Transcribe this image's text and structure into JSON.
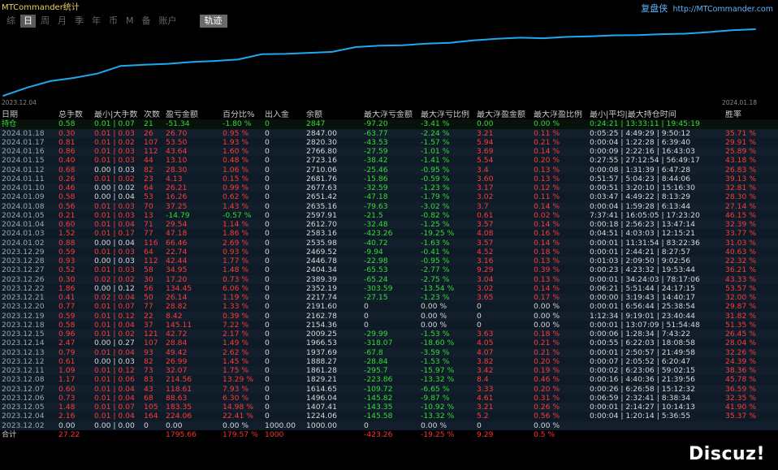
{
  "window": {
    "title_overlay": "MTCommander统计",
    "brand_name": "复盘侠",
    "brand_url": "http://MTCommander.com"
  },
  "tabs": [
    "综",
    "日",
    "周",
    "月",
    "季",
    "年",
    "币",
    "M",
    "备",
    "账户"
  ],
  "active_tab": "日",
  "track_button": "轨迹",
  "colors": {
    "positive": "#ff3b3b",
    "negative": "#33dd33",
    "line": "#1ea8f0"
  },
  "chart_data": {
    "type": "line",
    "x_tick_labels": [
      "2023.12.04",
      "2024.01.18"
    ],
    "series": [
      {
        "x": [
          "2023.12.02",
          "2023.12.04",
          "2023.12.05",
          "2023.12.06",
          "2023.12.07",
          "2023.12.08",
          "2023.12.11",
          "2023.12.12",
          "2023.12.13",
          "2023.12.14",
          "2023.12.15",
          "2023.12.18",
          "2023.12.19",
          "2023.12.20",
          "2023.12.21",
          "2023.12.22",
          "2023.12.26",
          "2023.12.27",
          "2023.12.28",
          "2023.12.29",
          "2024.01.02",
          "2024.01.03",
          "2024.01.04",
          "2024.01.05",
          "2024.01.08",
          "2024.01.09",
          "2024.01.10",
          "2024.01.11",
          "2024.01.12",
          "2024.01.15",
          "2024.01.16",
          "2024.01.17",
          "2024.01.18"
        ],
        "y": [
          1000,
          1224.06,
          1407.41,
          1496.04,
          1614.65,
          1829.21,
          1861.28,
          1888.27,
          1937.69,
          1966.53,
          2009.25,
          2154.36,
          2162.78,
          2191.6,
          2217.74,
          2352.19,
          2389.39,
          2404.34,
          2446.78,
          2469.52,
          2535.98,
          2583.16,
          2612.7,
          2597.91,
          2635.16,
          2651.42,
          2677.63,
          2681.76,
          2710.06,
          2723.16,
          2766.8,
          2820.3,
          2847
        ]
      }
    ]
  },
  "table": {
    "headers": [
      "日期",
      "总手数",
      "最小|大手数",
      "次数",
      "盈亏金额",
      "百分比%",
      "出入金",
      "余额",
      "最大浮亏金额",
      "最大浮亏比例",
      "最大浮盈金额",
      "最大浮盈比例",
      "最小|平均|最大持仓时间",
      "胜率"
    ],
    "holding": [
      "持仓",
      "0.58",
      "0.01 | 0.07",
      "21",
      "-51.34",
      "-1.80 %",
      "0",
      "2847",
      "-97.20",
      "-3.41 %",
      "0.00",
      "0.00 %",
      "0:24:21 | 13:33:11 | 19:45:19",
      ""
    ],
    "rows": [
      [
        "2024.01.18",
        "0.30",
        "0.01 | 0.03",
        "26",
        "26.70",
        "0.95 %",
        "0",
        "2847.00",
        "-63.77",
        "-2.24 %",
        "3.21",
        "0.11 %",
        "0:05:25 | 4:49:29 | 9:50:12",
        "35.71 %"
      ],
      [
        "2024.01.17",
        "0.81",
        "0.01 | 0.02",
        "107",
        "53.50",
        "1.93 %",
        "0",
        "2820.30",
        "-43.53",
        "-1.57 %",
        "5.94",
        "0.21 %",
        "0:00:04 | 1:22:28 | 6:39:40",
        "29.91 %"
      ],
      [
        "2024.01.16",
        "0.86",
        "0.01 | 0.03",
        "112",
        "43.64",
        "1.60 %",
        "0",
        "2766.80",
        "-27.59",
        "-1.01 %",
        "3.69",
        "0.14 %",
        "0:00:09 | 2:22:16 | 16:43:03",
        "25.89 %"
      ],
      [
        "2024.01.15",
        "0.40",
        "0.01 | 0.03",
        "44",
        "13.10",
        "0.48 %",
        "0",
        "2723.16",
        "-38.42",
        "-1.41 %",
        "5.54",
        "0.20 %",
        "0:27:55 | 27:12:54 | 56:49:17",
        "43.18 %"
      ],
      [
        "2024.01.12",
        "0.68",
        "0.00 | 0.03",
        "82",
        "28.30",
        "1.06 %",
        "0",
        "2710.06",
        "-25.46",
        "-0.95 %",
        "3.4",
        "0.13 %",
        "0:00:08 | 1:31:39 | 6:47:28",
        "26.83 %"
      ],
      [
        "2024.01.11",
        "0.26",
        "0.01 | 0.02",
        "23",
        "4.13",
        "0.15 %",
        "0",
        "2681.76",
        "-15.86",
        "-0.59 %",
        "3.60",
        "0.13 %",
        "0:51:57 | 5:04:23 | 8:44:06",
        "39.13 %"
      ],
      [
        "2024.01.10",
        "0.46",
        "0.00 | 0.02",
        "64",
        "26.21",
        "0.99 %",
        "0",
        "2677.63",
        "-32.59",
        "-1.23 %",
        "3.17",
        "0.12 %",
        "0:00:51 | 3:20:10 | 15:16:30",
        "32.81 %"
      ],
      [
        "2024.01.09",
        "0.58",
        "0.00 | 0.04",
        "53",
        "16.26",
        "0.62 %",
        "0",
        "2651.42",
        "-47.18",
        "-1.79 %",
        "3.02",
        "0.11 %",
        "0:03:47 | 4:49:22 | 8:13:29",
        "28.30 %"
      ],
      [
        "2024.01.08",
        "0.56",
        "0.01 | 0.03",
        "70",
        "37.25",
        "1.43 %",
        "0",
        "2635.16",
        "-79.63",
        "-3.02 %",
        "3.7",
        "0.14 %",
        "0:00:04 | 1:59:28 | 6:13:44",
        "27.14 %"
      ],
      [
        "2024.01.05",
        "0.21",
        "0.01 | 0.03",
        "13",
        "-14.79",
        "-0.57 %",
        "0",
        "2597.91",
        "-21.5",
        "-0.82 %",
        "0.61",
        "0.02 %",
        "7:37:41 | 16:05:05 | 17:23:20",
        "46.15 %"
      ],
      [
        "2024.01.04",
        "0.60",
        "0.01 | 0.04",
        "71",
        "29.54",
        "1.14 %",
        "0",
        "2612.70",
        "-32.48",
        "-1.25 %",
        "3.57",
        "0.14 %",
        "0:00:18 | 2:56:23 | 13:47:14",
        "32.39 %"
      ],
      [
        "2024.01.03",
        "1.52",
        "0.01 | 0.17",
        "77",
        "47.18",
        "1.86 %",
        "0",
        "2583.16",
        "-423.26",
        "-19.25 %",
        "4.08",
        "0.16 %",
        "0:04:51 | 4:03:03 | 12:15:21",
        "33.77 %"
      ],
      [
        "2024.01.02",
        "0.88",
        "0.00 | 0.04",
        "116",
        "66.46",
        "2.69 %",
        "0",
        "2535.98",
        "-40.72",
        "-1.63 %",
        "3.57",
        "0.14 %",
        "0:00:01 | 11:31:54 | 83:22:36",
        "31.03 %"
      ],
      [
        "2023.12.29",
        "0.59",
        "0.01 | 0.03",
        "64",
        "22.74",
        "0.93 %",
        "0",
        "2469.52",
        "-9.94",
        "-0.41 %",
        "4.52",
        "0.18 %",
        "0:00:01 | 2:44:21 | 8:27:57",
        "40.63 %"
      ],
      [
        "2023.12.28",
        "0.93",
        "0.00 | 0.03",
        "112",
        "42.44",
        "1.77 %",
        "0",
        "2446.78",
        "-22.98",
        "-0.95 %",
        "3.16",
        "0.13 %",
        "0:01:03 | 2:09:50 | 9:02:56",
        "22.32 %"
      ],
      [
        "2023.12.27",
        "0.52",
        "0.01 | 0.03",
        "58",
        "34.95",
        "1.48 %",
        "0",
        "2404.34",
        "-65.53",
        "-2.77 %",
        "9.29",
        "0.39 %",
        "0:00:23 | 4:23:32 | 19:53:44",
        "36.21 %"
      ],
      [
        "2023.12.26",
        "0.30",
        "0.02 | 0.02",
        "30",
        "17.20",
        "0.73 %",
        "0",
        "2389.39",
        "-65.24",
        "-2.75 %",
        "3.04",
        "0.13 %",
        "0:00:01 | 34:24:03 | 78:17:06",
        "43.33 %"
      ],
      [
        "2023.12.22",
        "1.86",
        "0.00 | 0.12",
        "56",
        "134.45",
        "6.06 %",
        "0",
        "2352.19",
        "-303.59",
        "-13.54 %",
        "3.02",
        "0.14 %",
        "0:06:21 | 5:51:44 | 24:17:15",
        "53.57 %"
      ],
      [
        "2023.12.21",
        "0.41",
        "0.02 | 0.04",
        "50",
        "26.14",
        "1.19 %",
        "0",
        "2217.74",
        "-27.15",
        "-1.23 %",
        "3.65",
        "0.17 %",
        "0:00:00 | 3:19:43 | 14:40:17",
        "32.00 %"
      ],
      [
        "2023.12.20",
        "0.77",
        "0.01 | 0.07",
        "77",
        "28.82",
        "1.33 %",
        "0",
        "2191.60",
        "0",
        "0.00 %",
        "0",
        "0.00 %",
        "0:00:01 | 6:56:44 | 25:38:54",
        "29.87 %"
      ],
      [
        "2023.12.19",
        "0.59",
        "0.01 | 0.12",
        "22",
        "8.42",
        "0.39 %",
        "0",
        "2162.78",
        "0",
        "0.00 %",
        "0",
        "0.00 %",
        "1:12:34 | 9:19:01 | 23:40:44",
        "31.82 %"
      ],
      [
        "2023.12.18",
        "0.58",
        "0.01 | 0.04",
        "37",
        "145.11",
        "7.22 %",
        "0",
        "2154.36",
        "0",
        "0.00 %",
        "0",
        "0.00 %",
        "0:00:01 | 13:07:09 | 51:54:48",
        "51.35 %"
      ],
      [
        "2023.12.15",
        "0.96",
        "0.01 | 0.02",
        "121",
        "42.72",
        "2.17 %",
        "0",
        "2009.25",
        "-29.99",
        "-1.53 %",
        "3.63",
        "0.18 %",
        "0:00:06 | 1:28:34 | 7:43:22",
        "26.45 %"
      ],
      [
        "2023.12.14",
        "2.47",
        "0.00 | 0.27",
        "107",
        "28.84",
        "1.49 %",
        "0",
        "1966.53",
        "-318.07",
        "-18.60 %",
        "4.05",
        "0.21 %",
        "0:00:55 | 6:22:03 | 18:08:58",
        "28.04 %"
      ],
      [
        "2023.12.13",
        "0.79",
        "0.01 | 0.04",
        "93",
        "49.42",
        "2.62 %",
        "0",
        "1937.69",
        "-67.8",
        "-3.59 %",
        "4.07",
        "0.21 %",
        "0:00:01 | 2:50:57 | 21:49:58",
        "32.26 %"
      ],
      [
        "2023.12.12",
        "0.61",
        "0.00 | 0.03",
        "82",
        "26.99",
        "1.45 %",
        "0",
        "1888.27",
        "-28.84",
        "-1.53 %",
        "3.82",
        "0.20 %",
        "0:00:07 | 2:05:52 | 6:20:47",
        "24.39 %"
      ],
      [
        "2023.12.11",
        "1.09",
        "0.01 | 0.12",
        "73",
        "32.07",
        "1.75 %",
        "0",
        "1861.28",
        "-295.7",
        "-15.97 %",
        "3.42",
        "0.19 %",
        "0:00:02 | 6:23:06 | 59:02:15",
        "38.36 %"
      ],
      [
        "2023.12.08",
        "1.17",
        "0.01 | 0.06",
        "83",
        "214.56",
        "13.29 %",
        "0",
        "1829.21",
        "-223.86",
        "-13.32 %",
        "8.4",
        "0.46 %",
        "0:00:16 | 4:40:36 | 21:39:56",
        "45.78 %"
      ],
      [
        "2023.12.07",
        "0.60",
        "0.01 | 0.04",
        "43",
        "118.61",
        "7.93 %",
        "0",
        "1614.65",
        "-109.72",
        "-6.65 %",
        "3.33",
        "0.20 %",
        "0:00:26 | 6:26:58 | 15:12:32",
        "36.59 %"
      ],
      [
        "2023.12.06",
        "0.73",
        "0.01 | 0.04",
        "68",
        "88.63",
        "6.30 %",
        "0",
        "1496.04",
        "-145.82",
        "-9.87 %",
        "4.61",
        "0.31 %",
        "0:06:59 | 2:32:41 | 8:38:34",
        "32.35 %"
      ],
      [
        "2023.12.05",
        "1.48",
        "0.01 | 0.07",
        "105",
        "183.35",
        "14.98 %",
        "0",
        "1407.41",
        "-143.35",
        "-10.92 %",
        "3.21",
        "0.26 %",
        "0:00:01 | 2:14:27 | 10:14:13",
        "41.90 %"
      ],
      [
        "2023.12.04",
        "2.16",
        "0.01 | 0.04",
        "164",
        "224.06",
        "22.41 %",
        "0",
        "1224.06",
        "-145.58",
        "-13.32 %",
        "5.2",
        "0.56 %",
        "0:00:04 | 1:20:14 | 5:36:55",
        "35.37 %"
      ],
      [
        "2023.12.02",
        "0.00",
        "0.00 | 0.00",
        "0",
        "0.00",
        "0.00 %",
        "1000.00",
        "1000.00",
        "0",
        "0.00 %",
        "0",
        "0.00 %",
        "",
        ""
      ]
    ],
    "total": [
      "合计",
      "27.22",
      "",
      "",
      "1795.66",
      "179.57 %",
      "1000",
      "",
      "-423.26",
      "-19.25 %",
      "9.29",
      "0.5 %",
      "",
      ""
    ]
  },
  "watermark": "Discuz!"
}
